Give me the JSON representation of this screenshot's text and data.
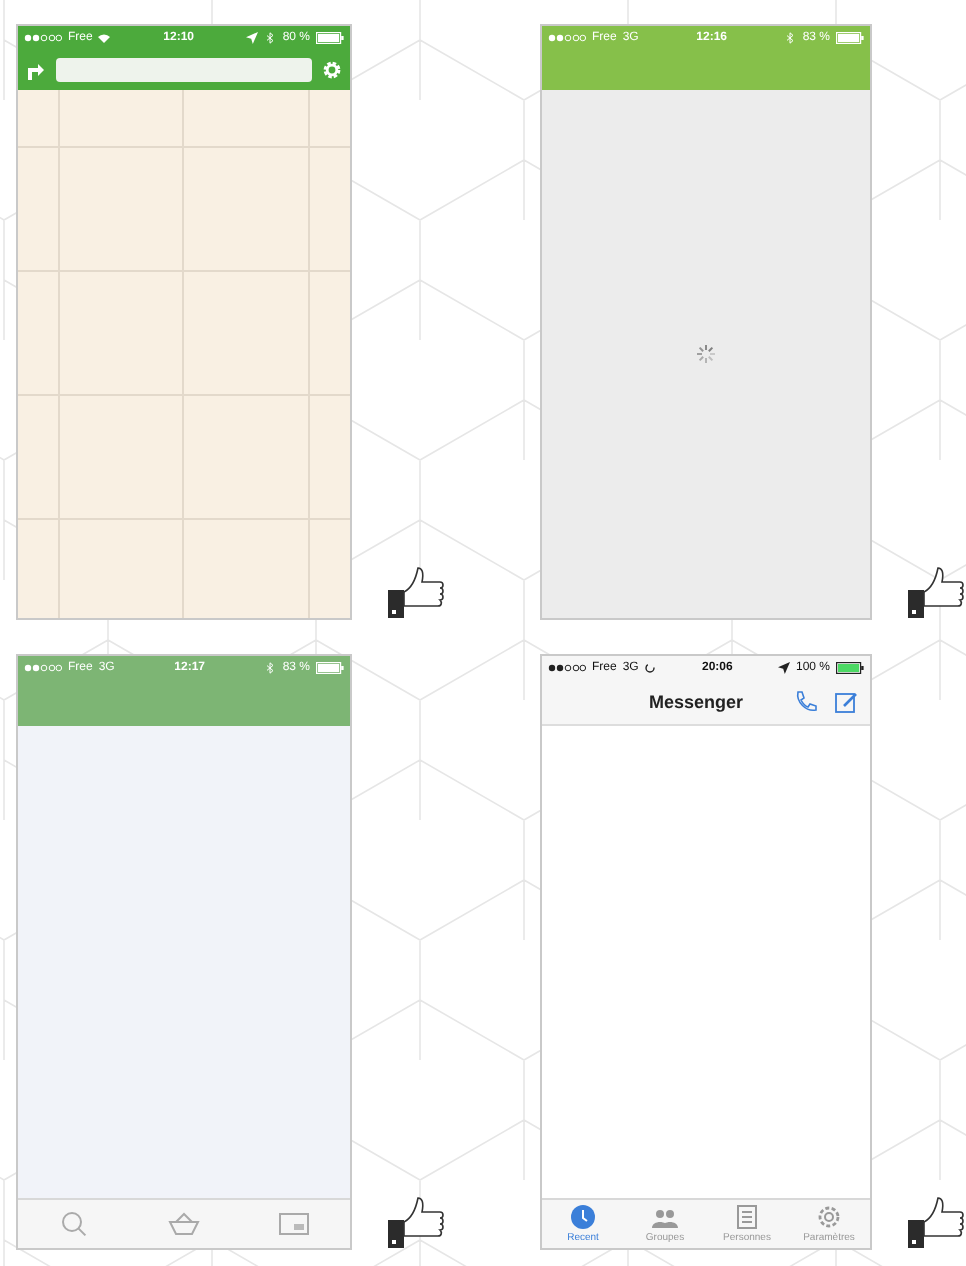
{
  "screens": [
    {
      "kind": "map",
      "status": {
        "carrier": "Free",
        "wifi": true,
        "time": "12:10",
        "location": true,
        "bluetooth": true,
        "battery": "80 %"
      }
    },
    {
      "kind": "loading",
      "status": {
        "carrier": "Free",
        "network": "3G",
        "time": "12:16",
        "bluetooth": true,
        "battery": "83 %"
      }
    },
    {
      "kind": "shop",
      "status": {
        "carrier": "Free",
        "network": "3G",
        "time": "12:17",
        "bluetooth": true,
        "battery": "83 %"
      }
    },
    {
      "kind": "messenger",
      "status": {
        "carrier": "Free",
        "network": "3G",
        "activity": true,
        "time": "20:06",
        "location": true,
        "battery": "100 %"
      },
      "title": "Messenger",
      "tabs": [
        {
          "label": "Recent",
          "selected": true
        },
        {
          "label": "Groupes",
          "selected": false
        },
        {
          "label": "Personnes",
          "selected": false
        },
        {
          "label": "Paramètres",
          "selected": false
        }
      ]
    }
  ]
}
